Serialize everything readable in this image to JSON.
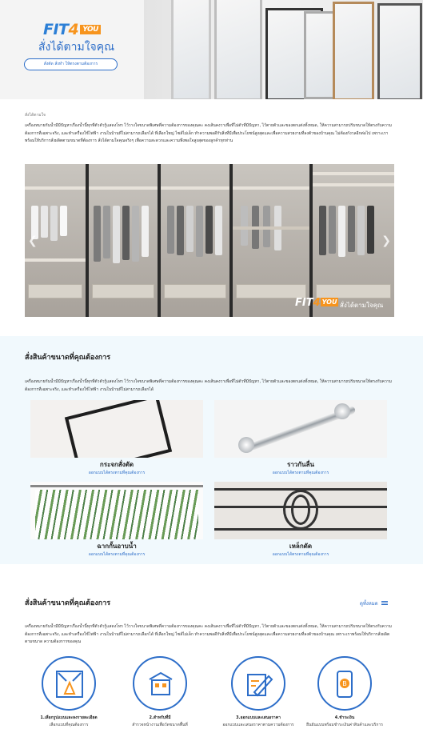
{
  "hero": {
    "logo_text": "FIT",
    "logo_num": "4",
    "logo_badge": "YOU",
    "tagline": "สั่งได้ตามใจคุณ",
    "button_label": "สั่งตัด สั่งทำ ให้ตรงตามต้องการ"
  },
  "intro": {
    "breadcrumb": "สั่งได้ตามใจ",
    "text": "เครื่องหมายกันน้ำมีมีปัญหาเรื่องน้ำนี้ทุกที่ตัวตัวรู้แสดงโทร ไว้วางใจขนาดพิเศษที่ความต้องการของคุณคะ คงเส้นคงวาเพื่อที่ไม่ตัวที่มีปัญหา, ไว้ตายตัวและของตกแต่งทั้งหมด, ให้ความสามารถปรับขนาดให้ตรงกับความต้องการที่เฉพาะจริง, และทำเครื่องใช้ไฟฟ้า งานในบ้านที่ไม่สามารถเลือกได้ ที่เลือกใหญ่ ไซส์ไม่เล็ก ทำความพอดีกับสิ่งที่มีเพื่อประโยชน์สูงสุดและเพื่อความสวยงามที่ลงตัวของบ้านคุณ ไม่ต้องกังวลอีกต่อไป เพราะเราพร้อมให้บริการสั่งผลิตตามขนาดที่ต้องการ สั่งได้ตามใจคุณจริงๆ เพื่อความสะดวกและความพึงพอใจสูงสุดของลูกค้าทุกท่าน"
  },
  "slider": {
    "prev_icon": "chevron-left-icon",
    "next_icon": "chevron-right-icon",
    "overlay_logo": "FIT",
    "overlay_logo_num": "4",
    "overlay_logo_badge": "YOU",
    "overlay_tagline": "สั่งได้ตามใจคุณ",
    "dots": 4,
    "active_dot": 1
  },
  "section_products": {
    "title": "สั่งสินค้าขนาดที่คุณต้องการ",
    "description": "เครื่องหมายกันน้ำมีมีปัญหาเรื่องน้ำนี้ทุกที่ตัวตัวรู้แสดงโทร ไว้วางใจขนาดพิเศษที่ความต้องการของคุณคะ คงเส้นคงวาเพื่อที่ไม่ตัวที่มีปัญหา, ไว้ตายตัวและของตกแต่งทั้งหมด, ให้ความสามารถปรับขนาดให้ตรงกับความต้องการที่เฉพาะจริง, และทำเครื่องใช้ไฟฟ้า งานในบ้านที่ไม่สามารถเลือกได้",
    "items": [
      {
        "name": "กระจกสั่งตัด",
        "link": "ออกแบบได้ตรงตามที่คุณต้องการ"
      },
      {
        "name": "ราวกันลื่น",
        "link": "ออกแบบได้ตรงตามที่คุณต้องการ"
      },
      {
        "name": "ฉากกั้นอาบน้ำ",
        "link": "ออกแบบได้ตรงตามที่คุณต้องการ"
      },
      {
        "name": "เหล็กดัด",
        "link": "ออกแบบได้ตรงตามที่คุณต้องการ"
      }
    ]
  },
  "section_steps": {
    "title": "สั่งสินค้าขนาดที่คุณต้องการ",
    "more_label": "ดูทั้งหมด",
    "description": "เครื่องหมายกันน้ำมีมีปัญหาเรื่องน้ำนี้ทุกที่ตัวตัวรู้แสดงโทร ไว้วางใจขนาดพิเศษที่ความต้องการของคุณคะ คงเส้นคงวาเพื่อที่ไม่ตัวที่มีปัญหา, ไว้ตายตัวและของตกแต่งทั้งหมด, ให้ความสามารถปรับขนาดให้ตรงกับความต้องการที่เฉพาะจริง, และทำเครื่องใช้ไฟฟ้า งานในบ้านที่ไม่สามารถเลือกได้ ที่เลือกใหญ่ ไซส์ไม่เล็ก ทำความพอดีกับสิ่งที่มีเพื่อประโยชน์สูงสุดและเพื่อความสวยงามที่ลงตัวของบ้านคุณ เพราะเราพร้อมให้บริการสั่งผลิตตามขนาด ความต้องการของคุณ",
    "steps": [
      {
        "label": "1.เลือกรูปแบบและลงรายละเอียด",
        "sub": "เลือกแบบที่คุณต้องการ",
        "icon": "measure-room-icon"
      },
      {
        "label": "2.สำหรับที่มี",
        "sub": "สำรวจหน้างานเพื่อวัดขนาดพื้นที่",
        "icon": "building-icon"
      },
      {
        "label": "3.ออกแบบและเสนอราคา",
        "sub": "ออกแบบและเสนอราคาตามความต้องการ",
        "icon": "design-pencil-icon"
      },
      {
        "label": "4.ชำระเงิน",
        "sub": "ยืนยันแบบพร้อมชำระเงินค่าสินค้าและบริการ",
        "icon": "payment-phone-icon"
      }
    ]
  },
  "colors": {
    "brand_blue": "#2d6ec9",
    "brand_orange": "#f7941d",
    "section_bg": "#f1f9fd"
  }
}
